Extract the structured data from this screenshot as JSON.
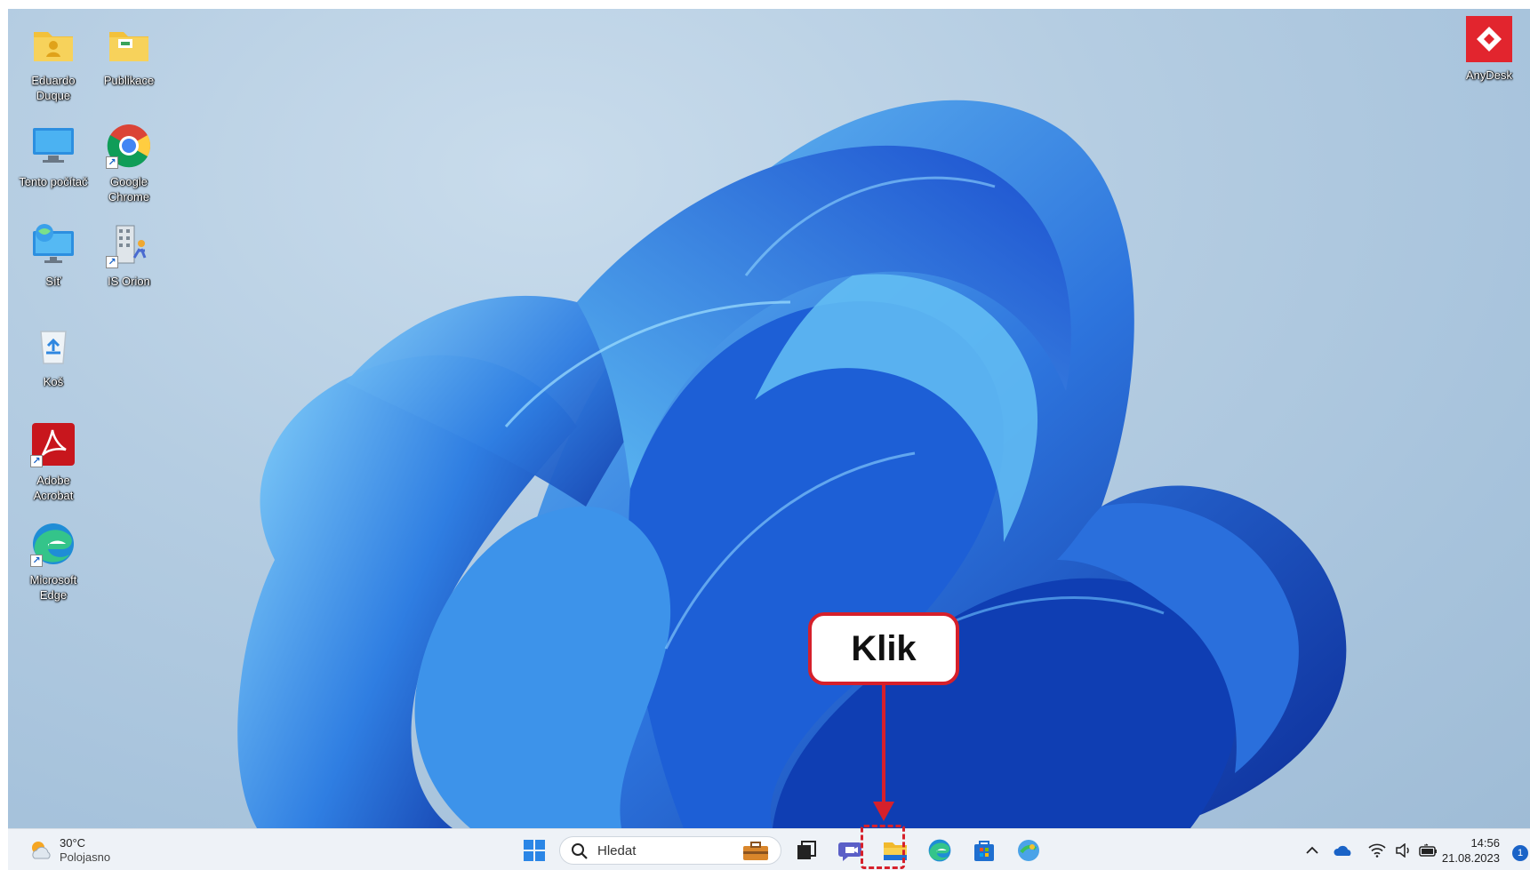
{
  "desktop_icons": [
    {
      "id": "user-folder",
      "label": "Eduardo\nDuque"
    },
    {
      "id": "publikace",
      "label": "Publikace"
    },
    {
      "id": "this-pc",
      "label": "Tento počítač"
    },
    {
      "id": "chrome",
      "label": "Google\nChrome"
    },
    {
      "id": "network",
      "label": "Síť"
    },
    {
      "id": "is-orion",
      "label": "IS Orion"
    },
    {
      "id": "recycle-bin",
      "label": "Koš"
    },
    {
      "id": "acrobat",
      "label": "Adobe\nAcrobat"
    },
    {
      "id": "edge",
      "label": "Microsoft\nEdge"
    },
    {
      "id": "anydesk",
      "label": "AnyDesk"
    }
  ],
  "taskbar": {
    "weather": {
      "temp": "30°C",
      "condition": "Polojasno"
    },
    "search_placeholder": "Hledat",
    "apps": [
      "start-icon",
      "briefcase-icon",
      "task-view-icon",
      "teams-chat-icon",
      "file-explorer-icon",
      "edge-icon",
      "store-icon",
      "app-icon"
    ],
    "tray": [
      "chevron-up-icon",
      "onedrive-icon",
      "wifi-icon",
      "volume-icon",
      "battery-icon"
    ],
    "clock_time": "14:56",
    "clock_date": "21.08.2023",
    "notification_count": "1"
  },
  "annotation": {
    "callout_text": "Klik",
    "color": "#d6202b"
  }
}
